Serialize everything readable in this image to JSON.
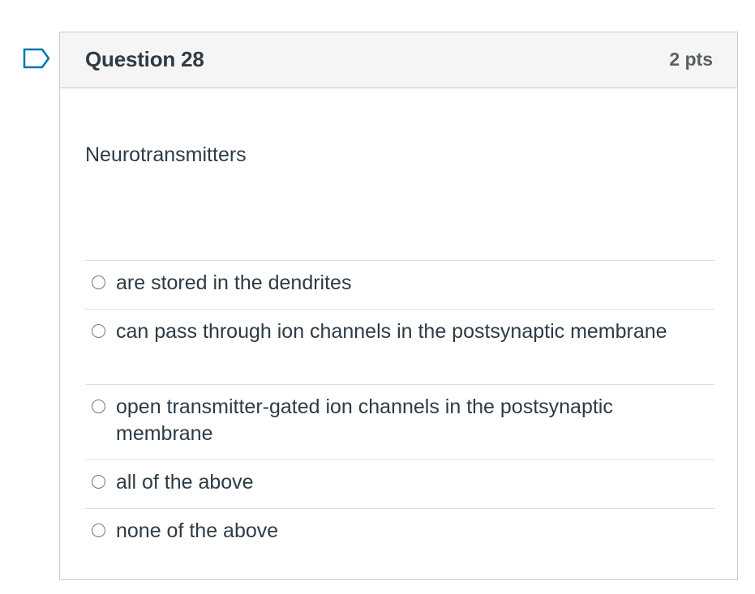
{
  "question": {
    "title": "Question 28",
    "points": "2 pts",
    "text": "Neurotransmitters",
    "flag_icon": "bookmark-flag-outline",
    "accent_color": "#0374b5"
  },
  "answers": [
    {
      "label": "are stored in the dendrites",
      "selected": false
    },
    {
      "label": "can pass through ion channels in the postsynaptic membrane",
      "selected": false
    },
    {
      "label": "open transmitter-gated ion channels in the postsynaptic membrane",
      "selected": false
    },
    {
      "label": "all of the above",
      "selected": false
    },
    {
      "label": "none of the above",
      "selected": false
    }
  ]
}
